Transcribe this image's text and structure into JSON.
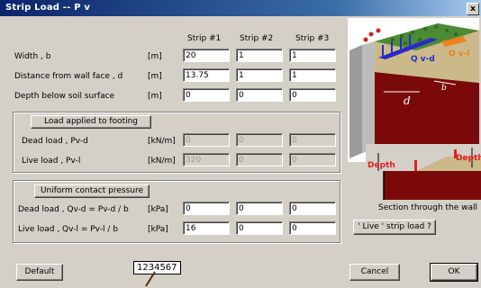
{
  "window": {
    "title": "Strip Load  --  P v",
    "close": "x"
  },
  "columns": [
    "Strip #1",
    "Strip #2",
    "Strip #3"
  ],
  "geometry_rows": [
    {
      "label": "Width ,  b",
      "unit": "[m]",
      "values": [
        "20",
        "1",
        "1"
      ]
    },
    {
      "label": "Distance from wall face ,  d",
      "unit": "[m]",
      "values": [
        "13.75",
        "1",
        "1"
      ]
    },
    {
      "label": "Depth below soil surface",
      "unit": "[m]",
      "values": [
        "0",
        "0",
        "0"
      ]
    }
  ],
  "footing_group": {
    "button": "Load applied to footing",
    "rows": [
      {
        "label": "Dead load ,  Pv-d",
        "unit": "[kN/m]",
        "values": [
          "0",
          "0",
          "0"
        ]
      },
      {
        "label": "Live load ,  Pv-l",
        "unit": "[kN/m]",
        "values": [
          "320",
          "0",
          "0"
        ]
      }
    ]
  },
  "contact_group": {
    "button": "Uniform contact pressure",
    "rows": [
      {
        "label": "Dead load ,  Qv-d = Pv-d / b",
        "unit": "[kPa]",
        "values": [
          "0",
          "0",
          "0"
        ]
      },
      {
        "label": "Live load ,   Qv-l = Pv-l / b",
        "unit": "[kPa]",
        "values": [
          "16",
          "0",
          "0"
        ]
      }
    ]
  },
  "illustration": {
    "label_qvd": "Q v-d",
    "label_qvl": "Q v-l",
    "label_d": "d",
    "label_b": "b",
    "depth_left": "Depth",
    "depth_right": "Depth",
    "caption": "Section through the wall"
  },
  "buttons": {
    "live_strip": "' Live '  strip load ?",
    "default": "Default",
    "cancel": "Cancel",
    "ok": "OK"
  },
  "tooltip": {
    "text": "1234567"
  },
  "colors": {
    "soil_red": "#7a0a0a",
    "grass_green": "#3c7a2a",
    "wall_gray": "#a8a8a8",
    "strip_blue": "#2a2ac8"
  }
}
